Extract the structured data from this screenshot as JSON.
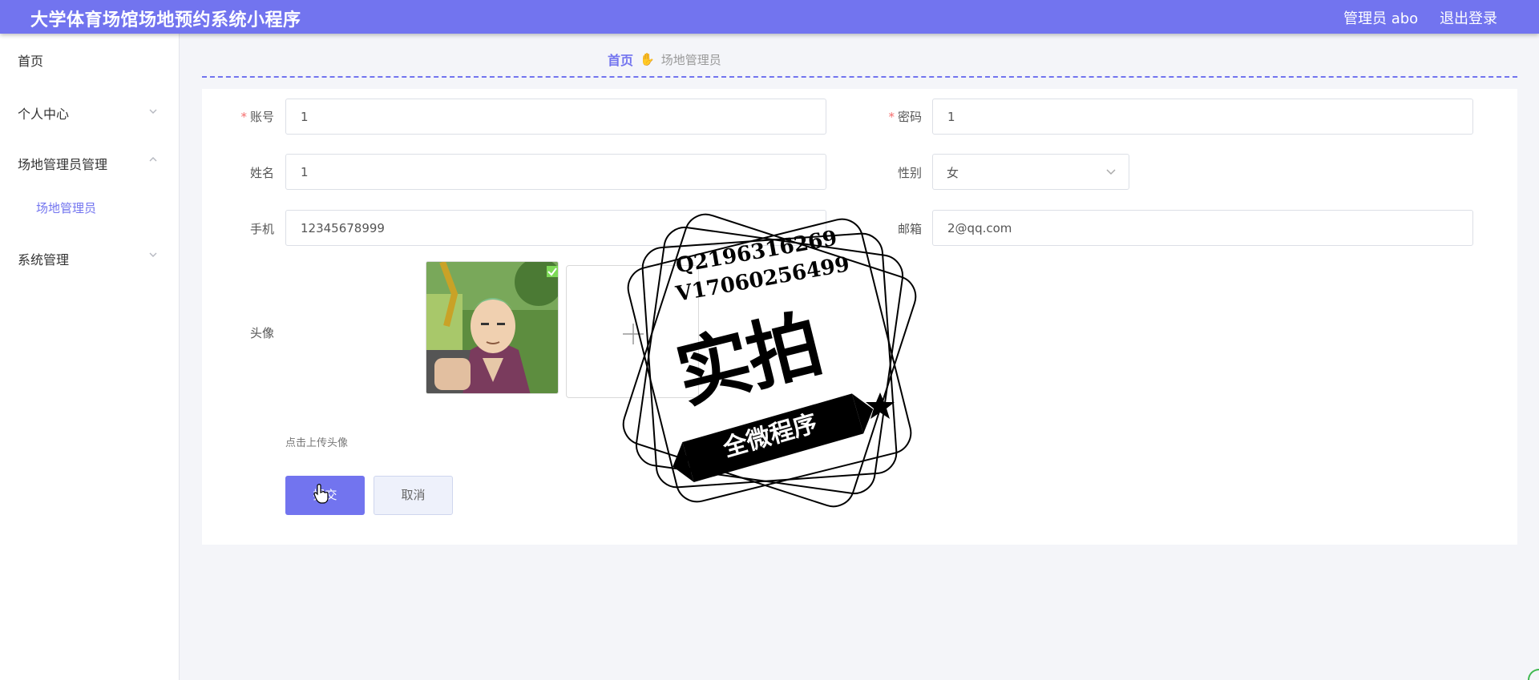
{
  "header": {
    "title": "大学体育场馆场地预约系统小程序",
    "user_label": "管理员 abo",
    "logout_label": "退出登录"
  },
  "sidebar": {
    "items": [
      {
        "label": "首页"
      },
      {
        "label": "个人中心"
      },
      {
        "label": "场地管理员管理"
      },
      {
        "label": "场地管理员"
      },
      {
        "label": "系统管理"
      }
    ]
  },
  "breadcrumb": {
    "home": "首页",
    "icon": "hand-icon",
    "current": "场地管理员"
  },
  "form": {
    "account": {
      "label": "账号",
      "value": "1",
      "required": true
    },
    "password": {
      "label": "密码",
      "value": "1",
      "required": true
    },
    "name": {
      "label": "姓名",
      "value": "1"
    },
    "gender": {
      "label": "性别",
      "value": "女"
    },
    "phone": {
      "label": "手机",
      "value": "12345678999"
    },
    "email": {
      "label": "邮箱",
      "value": "2@qq.com"
    },
    "avatar": {
      "label": "头像",
      "hint": "点击上传头像"
    },
    "submit_label": "提交",
    "cancel_label": "取消"
  },
  "watermark": {
    "line1": "Q2196316269",
    "line2": "V17060256499",
    "big_text": "实拍",
    "ribbon_text": "全微程序"
  },
  "colors": {
    "accent": "#7274ef",
    "required": "#f56c6c"
  }
}
